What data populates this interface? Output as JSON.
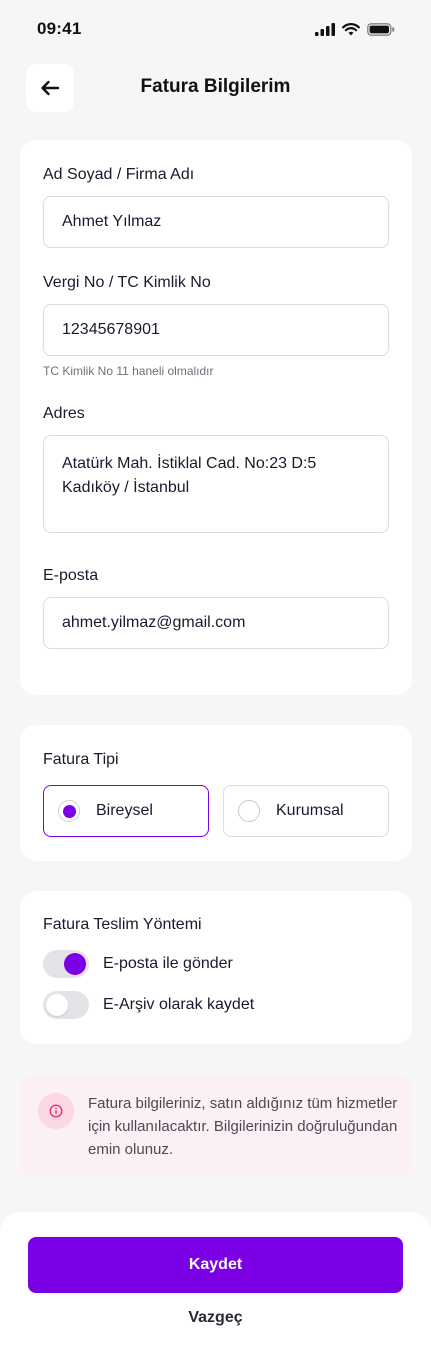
{
  "status_bar": {
    "time": "09:41"
  },
  "header": {
    "title": "Fatura Bilgilerim",
    "back_icon": "arrow-left-icon"
  },
  "form": {
    "name": {
      "label": "Ad Soyad / Firma Adı",
      "value": "Ahmet Yılmaz"
    },
    "tax_id": {
      "label": "Vergi No / TC Kimlik No",
      "value": "12345678901",
      "hint": "TC Kimlik No 11 haneli olmalıdır"
    },
    "address": {
      "label": "Adres",
      "value": "Atatürk Mah. İstiklal Cad. No:23 D:5 Kadıköy / İstanbul"
    },
    "email": {
      "label": "E-posta",
      "value": "ahmet.yilmaz@gmail.com"
    }
  },
  "invoice_type": {
    "title": "Fatura Tipi",
    "options": [
      {
        "label": "Bireysel",
        "selected": true
      },
      {
        "label": "Kurumsal",
        "selected": false
      }
    ]
  },
  "delivery": {
    "title": "Fatura Teslim Yöntemi",
    "options": [
      {
        "label": "E-posta ile gönder",
        "on": true
      },
      {
        "label": "E-Arşiv olarak kaydet",
        "on": false
      }
    ]
  },
  "info": {
    "icon": "info-icon",
    "text": "Fatura bilgileriniz, satın aldığınız tüm hizmetler için kullanılacaktır. Bilgilerinizin doğruluğundan emin olunuz."
  },
  "actions": {
    "save_label": "Kaydet",
    "cancel_label": "Vazgeç"
  },
  "colors": {
    "accent": "#7b00e6",
    "background": "#f6f6f8",
    "info_background": "#fbf1f4",
    "info_icon": "#e8336d"
  }
}
